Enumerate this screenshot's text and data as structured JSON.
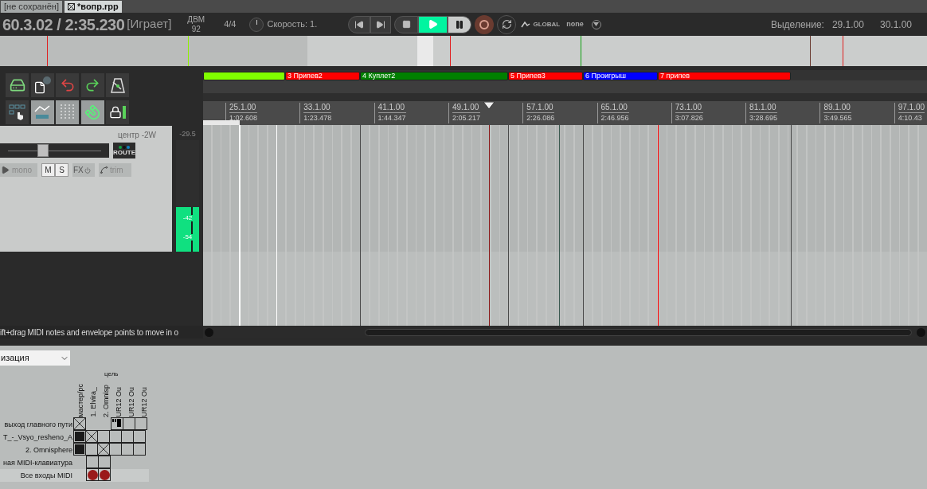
{
  "tabs": [
    {
      "label": "[не сохранён]",
      "selected": false
    },
    {
      "label": "*вопр.rpp",
      "selected": true
    }
  ],
  "transport": {
    "position": "60.3.02 / 2:35.230",
    "state": "[Играет]",
    "tempo_label": "ДВМ",
    "tempo": "92",
    "time_signature": "4/4",
    "rate": "Скорость: 1.",
    "buttons": [
      {
        "kind": "prev",
        "selected": false
      },
      {
        "kind": "next",
        "selected": false
      },
      {
        "kind": "stop",
        "selected": false
      },
      {
        "kind": "play",
        "selected": true
      },
      {
        "kind": "pause",
        "selected": false
      },
      {
        "kind": "record",
        "selected": false
      },
      {
        "kind": "repeat",
        "selected": false
      }
    ],
    "automation_mode": "GLOBAL",
    "automation_value": "none",
    "selection_label": "Выделение:",
    "selection_start": "29.1.00",
    "selection_end": "30.1.00"
  },
  "toolbar": [
    {
      "kind": "save",
      "on": false
    },
    {
      "kind": "info",
      "on": false
    },
    {
      "kind": "undo",
      "on": false
    },
    {
      "kind": "redo",
      "on": false
    },
    {
      "kind": "metronome",
      "on": false
    },
    {
      "kind": "grid-pointer",
      "on": false
    },
    {
      "kind": "envelope",
      "on": true
    },
    {
      "kind": "grid",
      "on": true
    },
    {
      "kind": "magnet",
      "on": true
    },
    {
      "kind": "lock",
      "on": false
    }
  ],
  "track": {
    "pan": "центр -2W",
    "peak": "-29.5",
    "fader": {
      "level": 0.38
    },
    "route": "ROUTE",
    "mono": "mono",
    "mute": "M",
    "solo": "S",
    "fx": "FX",
    "trim": "trim",
    "meter": {
      "level": 0.4,
      "labels": [
        "-42",
        "-54"
      ]
    }
  },
  "regions": [
    {
      "color": "#80ff00"
    },
    {
      "number": "3",
      "name": "Припев2",
      "color": "#ff0000"
    },
    {
      "number": "4",
      "name": "Куплет2",
      "color": "#008000"
    },
    {
      "number": "5",
      "name": "Припев3",
      "color": "#ff0000"
    },
    {
      "number": "6",
      "name": "Проигрыш",
      "color": "#0000ff"
    },
    {
      "number": "7",
      "name": "припев",
      "color": "#ff0000"
    }
  ],
  "ruler": [
    {
      "bar": "25.1.00",
      "time": "1:02.608"
    },
    {
      "bar": "33.1.00",
      "time": "1:23.478"
    },
    {
      "bar": "41.1.00",
      "time": "1:44.347"
    },
    {
      "bar": "49.1.00",
      "time": "2:05.217"
    },
    {
      "bar": "57.1.00",
      "time": "2:26.086"
    },
    {
      "bar": "65.1.00",
      "time": "2:46.956"
    },
    {
      "bar": "73.1.00",
      "time": "3:07.826"
    },
    {
      "bar": "81.1.00",
      "time": "3:28.695"
    },
    {
      "bar": "89.1.00",
      "time": "3:49.565"
    },
    {
      "bar": "97.1.00",
      "time": "4:10.43"
    }
  ],
  "status": "ift+drag MIDI notes and envelope points to move in o",
  "routing": {
    "dropdown": "изация",
    "target_label": "цель",
    "columns": [
      "мастер/рс",
      "1. Elvira_",
      "2. Omnisp",
      "UR12 Ou",
      "UR12 Ou",
      "UR12 Ou"
    ],
    "rows": [
      {
        "label": "выход главного пути",
        "cells": [
          {
            "kind": "cross"
          },
          {
            "kind": "none"
          },
          {
            "kind": "none"
          },
          {
            "kind": "meter"
          },
          {
            "kind": "empty"
          },
          {
            "kind": "empty"
          }
        ]
      },
      {
        "label": "T_-_Vsyo_resheno_A",
        "cells": [
          {
            "kind": "filled"
          },
          {
            "kind": "cross"
          },
          {
            "kind": "empty"
          },
          {
            "kind": "empty"
          },
          {
            "kind": "empty"
          },
          {
            "kind": "empty"
          }
        ]
      },
      {
        "label": "2. Omnisphere",
        "cells": [
          {
            "kind": "filled"
          },
          {
            "kind": "empty"
          },
          {
            "kind": "cross"
          },
          {
            "kind": "empty"
          },
          {
            "kind": "empty"
          },
          {
            "kind": "empty"
          }
        ]
      },
      {
        "label": "ная MIDI-клавиатура",
        "cells": [
          {
            "kind": "none"
          },
          {
            "kind": "empty"
          },
          {
            "kind": "empty"
          },
          {
            "kind": "none"
          },
          {
            "kind": "none"
          },
          {
            "kind": "none"
          }
        ]
      },
      {
        "label": "Все входы MIDI",
        "cells": [
          {
            "kind": "none"
          },
          {
            "kind": "dot"
          },
          {
            "kind": "dot"
          },
          {
            "kind": "none"
          },
          {
            "kind": "none"
          },
          {
            "kind": "none"
          }
        ]
      }
    ]
  }
}
